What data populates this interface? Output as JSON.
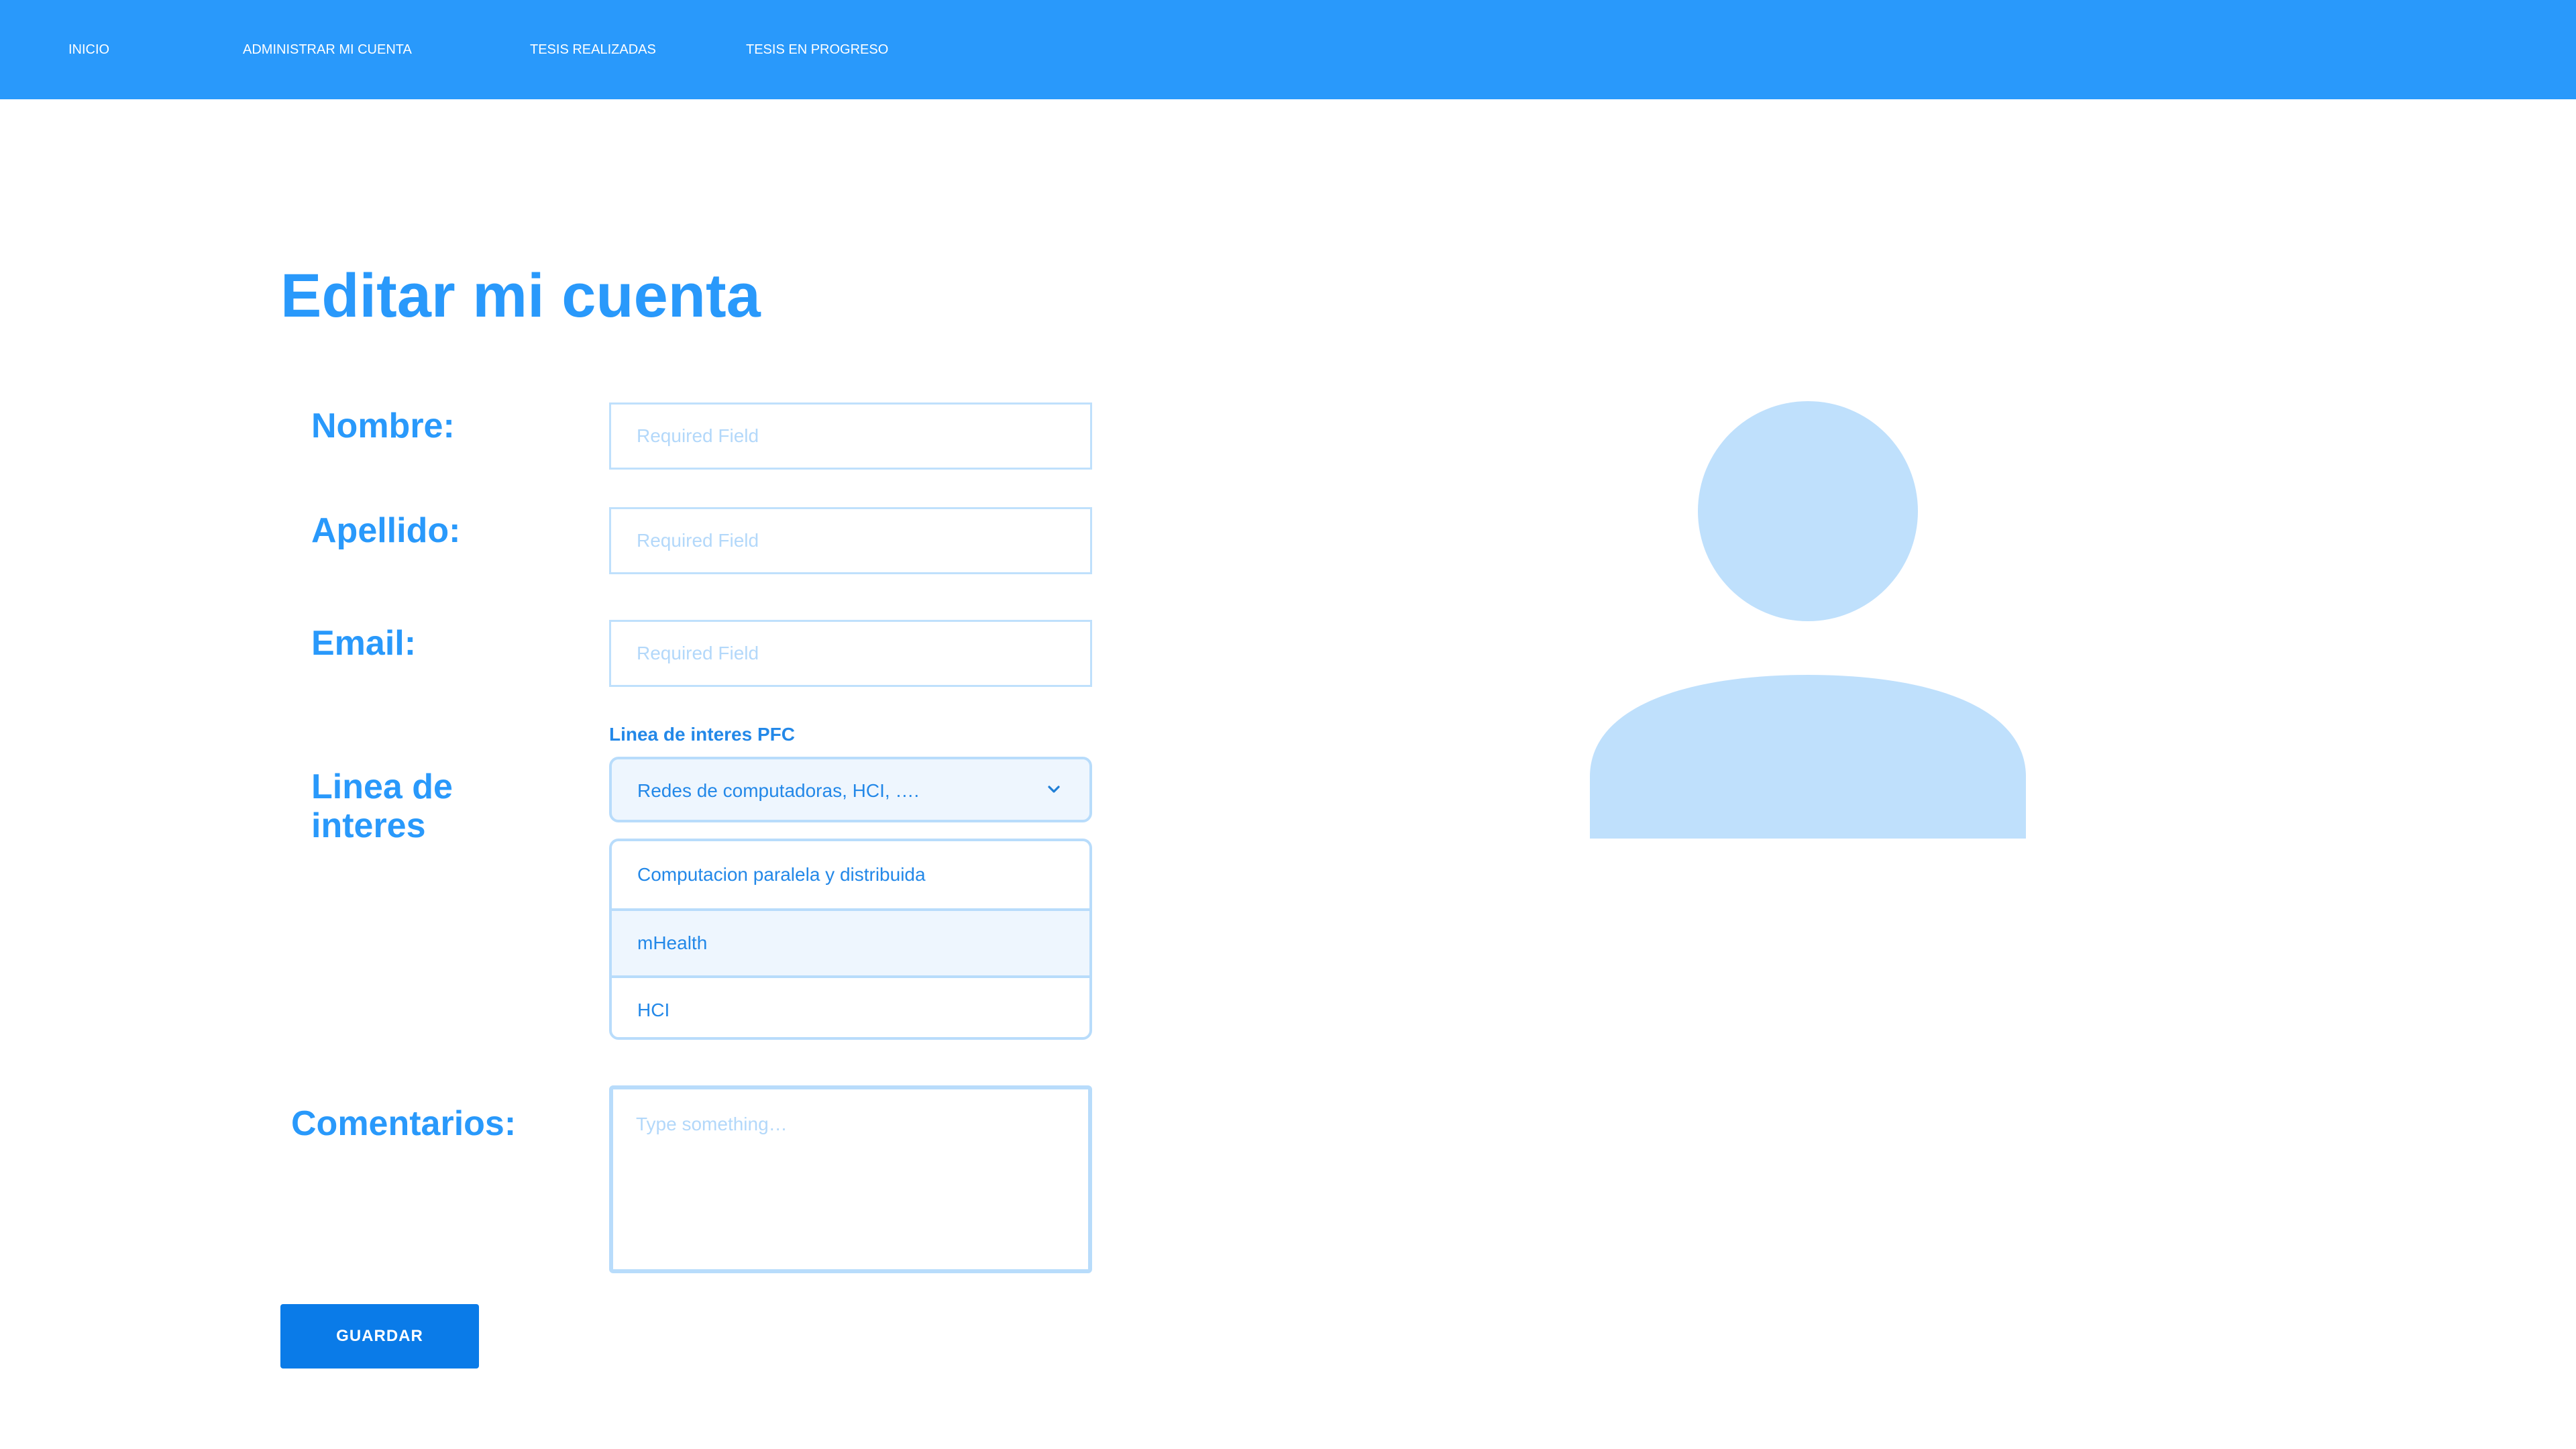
{
  "colors": {
    "brand": "#2999fb",
    "button": "#0a7be8",
    "field_border": "#b8dcfb",
    "avatar": "#bfe0fc"
  },
  "nav": {
    "items": [
      {
        "label": "INICIO"
      },
      {
        "label": "ADMINISTRAR MI CUENTA"
      },
      {
        "label": "TESIS REALIZADAS"
      },
      {
        "label": "TESIS EN PROGRESO"
      }
    ]
  },
  "page": {
    "title": "Editar mi cuenta"
  },
  "form": {
    "nombre": {
      "label": "Nombre:",
      "placeholder": "Required Field",
      "value": ""
    },
    "apellido": {
      "label": "Apellido:",
      "placeholder": "Required Field",
      "value": ""
    },
    "email": {
      "label": "Email:",
      "placeholder": "Required Field",
      "value": ""
    },
    "linea": {
      "label": "Linea de interes",
      "caption": "Linea de interes PFC",
      "selected": "Redes de computadoras, HCI, ….",
      "icon": "chevron-down-icon",
      "options": [
        {
          "label": "Computacion paralela y distribuida"
        },
        {
          "label": "mHealth"
        },
        {
          "label": "HCI"
        }
      ]
    },
    "comentarios": {
      "label": "Comentarios:",
      "placeholder": "Type something…",
      "value": ""
    },
    "save_label": "GUARDAR"
  },
  "avatar": {
    "icon": "user-avatar-icon"
  }
}
